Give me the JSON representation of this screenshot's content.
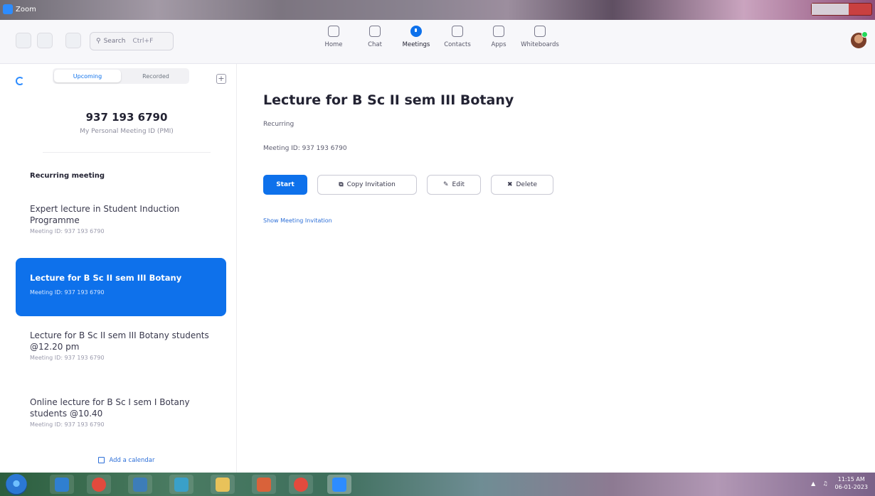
{
  "titlebar": {
    "app_name": "Zoom"
  },
  "search": {
    "label": "Search",
    "shortcut": "Ctrl+F"
  },
  "nav": {
    "tabs": [
      {
        "label": "Home",
        "icon": "home-icon"
      },
      {
        "label": "Chat",
        "icon": "chat-icon"
      },
      {
        "label": "Meetings",
        "icon": "meetings-icon",
        "active": true
      },
      {
        "label": "Contacts",
        "icon": "contacts-icon"
      },
      {
        "label": "Apps",
        "icon": "apps-icon"
      },
      {
        "label": "Whiteboards",
        "icon": "whiteboards-icon"
      }
    ]
  },
  "sidebar": {
    "segments": [
      "Upcoming",
      "Recorded"
    ],
    "pmi_number": "937 193 6790",
    "pmi_label": "My Personal Meeting ID (PMI)",
    "section_label": "Recurring meeting",
    "meetings": [
      {
        "title": "Expert lecture in Student Induction Programme",
        "meeting_id": "Meeting ID: 937 193 6790"
      },
      {
        "title": "Lecture for B Sc II sem III Botany",
        "meeting_id": "Meeting ID: 937 193 6790",
        "selected": true
      },
      {
        "title": "Lecture for B Sc II sem III Botany students @12.20 pm",
        "meeting_id": "Meeting ID: 937 193 6790"
      },
      {
        "title": "Online lecture for B Sc I sem I Botany students @10.40",
        "meeting_id": "Meeting ID: 937 193 6790"
      }
    ],
    "add_calendar": "Add a calendar"
  },
  "main": {
    "title": "Lecture for B Sc II sem III Botany",
    "recurrence": "Recurring",
    "meeting_id": "Meeting ID: 937 193 6790",
    "buttons": {
      "start": "Start",
      "copy": "Copy Invitation",
      "edit": "Edit",
      "delete": "Delete"
    },
    "show_invitation": "Show Meeting Invitation"
  },
  "taskbar": {
    "time": "11:15 AM",
    "date": "06-01-2023"
  },
  "colors": {
    "accent": "#0e71eb"
  }
}
